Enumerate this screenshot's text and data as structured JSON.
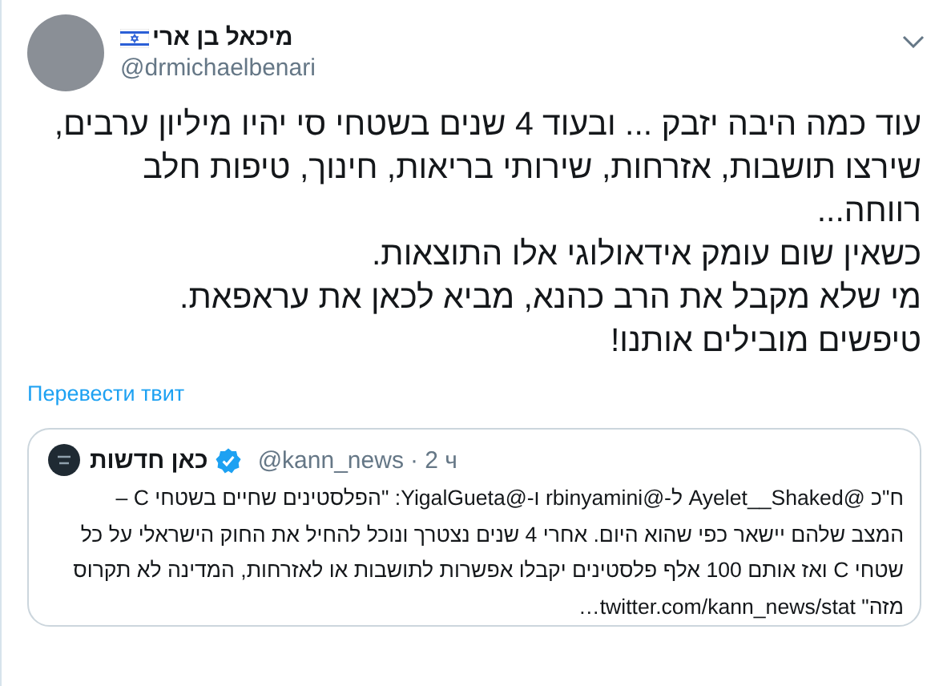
{
  "author": {
    "name": "מיכאל בן ארי",
    "handle": "@drmichaelbenari"
  },
  "tweet_text": [
    "עוד כמה היבה יזבק ... ובעוד 4 שנים בשטחי סי יהיו מיליון ערבים,",
    "שירצו תושבות, אזרחות, שירותי בריאות, חינוך, טיפות חלב",
    "רווחה...",
    "כשאין שום עומק אידאולוגי אלו התוצאות.",
    "מי שלא מקבל את הרב כהנא, מביא לכאן את עראפאת.",
    "טיפשים מובילים אותנו!"
  ],
  "translate_link": "Перевести твит",
  "quoted_tweet": {
    "name": "כאן חדשות",
    "verified": true,
    "handle": "@kann_news",
    "time": "· 2 ч",
    "text": [
      "ח\"כ @Ayelet__Shaked ל-@rbinyamini ו-@YigalGueta: \"הפלסטינים שחיים בשטחי C –",
      "המצב שלהם יישאר כפי שהוא היום. אחרי 4 שנים נצטרך ונוכל להחיל את החוק הישראלי על כל",
      "שטחי C ואז אותם 100 אלף פלסטינים יקבלו אפשרות לתושבות או לאזרחות, המדינה לא תקרוס",
      "מזה\" twitter.com/kann_news/stat…"
    ]
  }
}
